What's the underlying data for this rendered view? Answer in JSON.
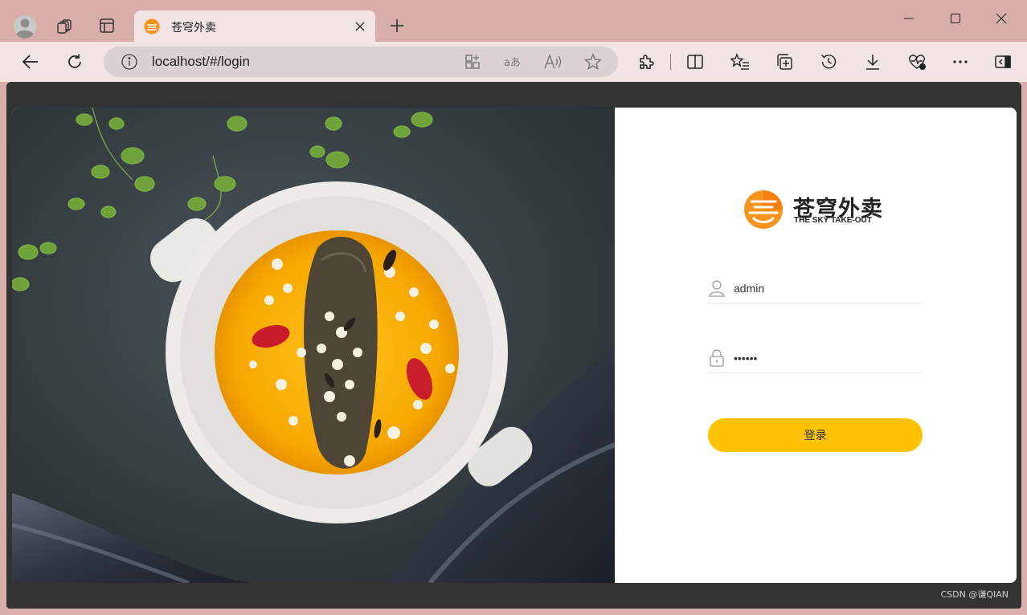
{
  "browser": {
    "tab_title": "苍穹外卖",
    "url": "localhost/#/login"
  },
  "login": {
    "logo_cn": "苍穹外卖",
    "logo_en": "THE SKY TAKE-OUT",
    "username_value": "admin",
    "password_value": "123456",
    "login_label": "登录"
  },
  "colors": {
    "accent": "#ffc200",
    "chrome": "#d9aeaa",
    "toolbar": "#f3e4e4"
  },
  "icons": [
    "profile-avatar-icon",
    "workspaces-icon",
    "tab-actions-icon",
    "close-icon",
    "plus-icon",
    "minimize-icon",
    "maximize-icon",
    "back-arrow-icon",
    "refresh-icon",
    "info-icon",
    "apps-icon",
    "translate-icon",
    "read-aloud-icon",
    "star-icon",
    "extensions-icon",
    "split-screen-icon",
    "favorites-icon",
    "collections-icon",
    "history-icon",
    "download-icon",
    "browser-essentials-icon",
    "more-icon",
    "sidebar-icon",
    "user-icon",
    "lock-icon"
  ],
  "watermark": "CSDN @谦QIAN"
}
